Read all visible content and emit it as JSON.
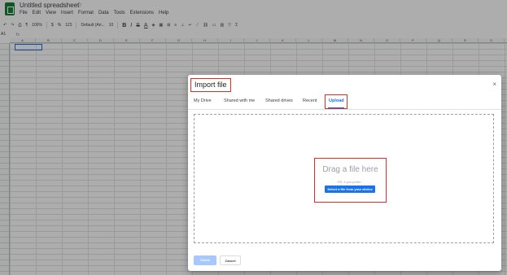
{
  "app": {
    "title": "Untitled spreadsheet",
    "menu": [
      "File",
      "Edit",
      "View",
      "Insert",
      "Format",
      "Data",
      "Tools",
      "Extensions",
      "Help"
    ],
    "toolbar": {
      "zoom": "100%",
      "currency": "$",
      "percent": "%",
      "number_format": "123",
      "font": "Default (Ari...",
      "font_size": "10",
      "bold": "B",
      "italic": "I",
      "strikethrough": "S",
      "text_color": "A"
    },
    "namebox": "A1",
    "formula_prefix": "fx",
    "columns": [
      "A",
      "B",
      "C",
      "D",
      "E",
      "F",
      "G",
      "H",
      "I",
      "J",
      "K",
      "L",
      "M",
      "N",
      "O",
      "P",
      "Q",
      "R",
      "S"
    ]
  },
  "dialog": {
    "title": "Import file",
    "close_icon": "×",
    "tabs": [
      {
        "label": "My Drive"
      },
      {
        "label": "Shared with me"
      },
      {
        "label": "Shared drives"
      },
      {
        "label": "Recent"
      },
      {
        "label": "Upload"
      }
    ],
    "active_tab": "Upload",
    "dropzone": {
      "drag_text": "Drag a file here",
      "or_text": "OR, if you prefer...",
      "select_button": "Select a file from your device"
    },
    "buttons": {
      "select": "Select",
      "cancel": "Cancel"
    }
  },
  "colors": {
    "accent": "#1a73e8",
    "highlight_border": "#d93025",
    "disabled_button": "#a8c7fa"
  }
}
